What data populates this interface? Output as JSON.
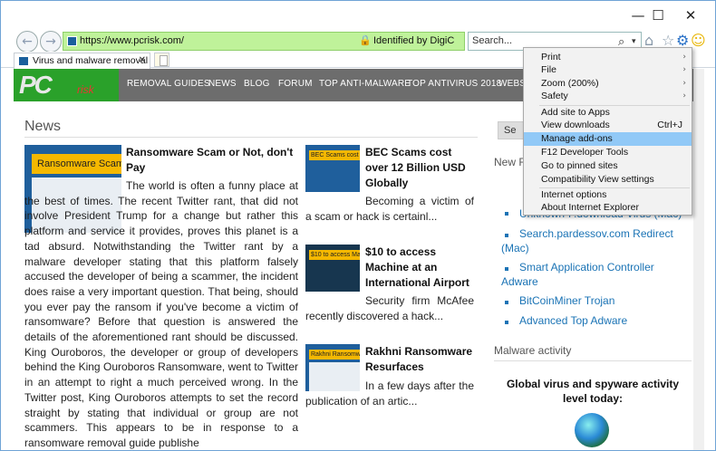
{
  "window": {
    "minimize": "—",
    "maximize": "☐",
    "close": "✕"
  },
  "toolbar": {
    "back_icon": "arrow-left-icon",
    "forward_icon": "arrow-right-icon",
    "url": "https://www.pcrisk.com/",
    "identity": "Identified by DigiC",
    "search_placeholder": "Search...",
    "search_icon": "⌕",
    "dropdown": "▾",
    "home": "⌂",
    "star": "☆",
    "gear": "⚙",
    "smiley": "☺"
  },
  "tab": {
    "title": "Virus and malware removal i...",
    "close": "✕"
  },
  "site": {
    "logo_main": "PC",
    "logo_sub": "risk",
    "nav": [
      "REMOVAL GUIDES",
      "NEWS",
      "BLOG",
      "FORUM",
      "TOP ANTI-MALWARE",
      "TOP ANTIVIRUS 2018",
      "WEBS"
    ]
  },
  "news": {
    "heading": "News",
    "main_article": {
      "thumb_label": "Ransomware Scam",
      "title": "Ransomware Scam or Not, don't Pay",
      "text": "The world is often a funny place at the best of times. The recent Twitter rant, that did not involve President Trump for a change but rather this platform and service it provides, proves this planet is a tad absurd. Notwithstanding the Twitter rant by a malware developer stating that this platform falsely accused the developer of being a scammer, the incident does raise a very important question. That being, should you ever pay the ransom if you've become a victim of ransomware? Before that question is answered the details of the aforementioned rant should be discussed. King Ouroboros, the developer or group of developers behind the King Ouroboros Ransomware, went to Twitter in an attempt to right a much perceived wrong. In the Twitter post, King Ouroboros attempts to set the record straight by stating that individual or group are not scammers. This appears to be in response to a ransomware removal guide publishe"
    },
    "side_articles": [
      {
        "thumb_label": "BEC Scams cost over",
        "title": "BEC Scams cost over 12 Billion USD Globally",
        "text": "Becoming a victim of a scam or hack is certainl..."
      },
      {
        "thumb_label": "$10 to access Ma",
        "title": "$10 to access Machine at an International Airport",
        "text": "Security firm McAfee recently discovered a hack..."
      },
      {
        "thumb_label": "Rakhni Ransomw",
        "title": "Rakhni Ransomware Resurfaces",
        "text": "In a few days after the publication of an artic..."
      }
    ]
  },
  "sidebar": {
    "search_btn": "Se",
    "new_heading": "New R",
    "links": [
      "Unknown-F.download Virus (Mac)",
      "Search.pardessov.com Redirect (Mac)",
      "Smart Application Controller Adware",
      "BitCoinMiner Trojan",
      "Advanced Top Adware"
    ],
    "malware_heading": "Malware activity",
    "activity_title": "Global virus and spyware activity level today:"
  },
  "menu": {
    "items": [
      {
        "label": "Print",
        "arrow": "›"
      },
      {
        "label": "File",
        "arrow": "›"
      },
      {
        "label": "Zoom (200%)",
        "arrow": "›"
      },
      {
        "label": "Safety",
        "arrow": "›"
      },
      {
        "label": "Add site to Apps"
      },
      {
        "label": "View downloads",
        "shortcut": "Ctrl+J"
      },
      {
        "label": "Manage add-ons"
      },
      {
        "label": "F12 Developer Tools"
      },
      {
        "label": "Go to pinned sites"
      },
      {
        "label": "Compatibility View settings"
      },
      {
        "label": "Internet options"
      },
      {
        "label": "About Internet Explorer"
      }
    ],
    "highlighted": "Manage add-ons"
  }
}
